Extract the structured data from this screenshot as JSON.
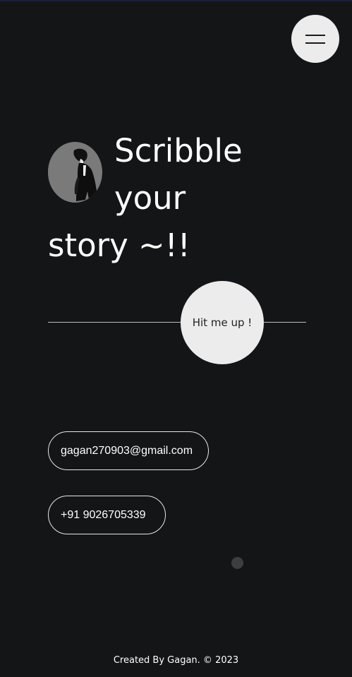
{
  "header": {
    "menu_icon": "hamburger-menu-icon"
  },
  "hero": {
    "avatar_alt": "profile illustration",
    "heading_line1": "Scribble",
    "heading_line2": "your",
    "heading_line3": "story ~!!"
  },
  "cta": {
    "label": "Hit me up !"
  },
  "contact": {
    "email": "gagan270903@gmail.com",
    "phone": "+91 9026705339"
  },
  "footer": {
    "credit": "Created By Gagan. © 2023"
  },
  "colors": {
    "background": "#141517",
    "button_fill": "#ececec",
    "text": "#ffffff",
    "dot": "#3d3e40"
  }
}
